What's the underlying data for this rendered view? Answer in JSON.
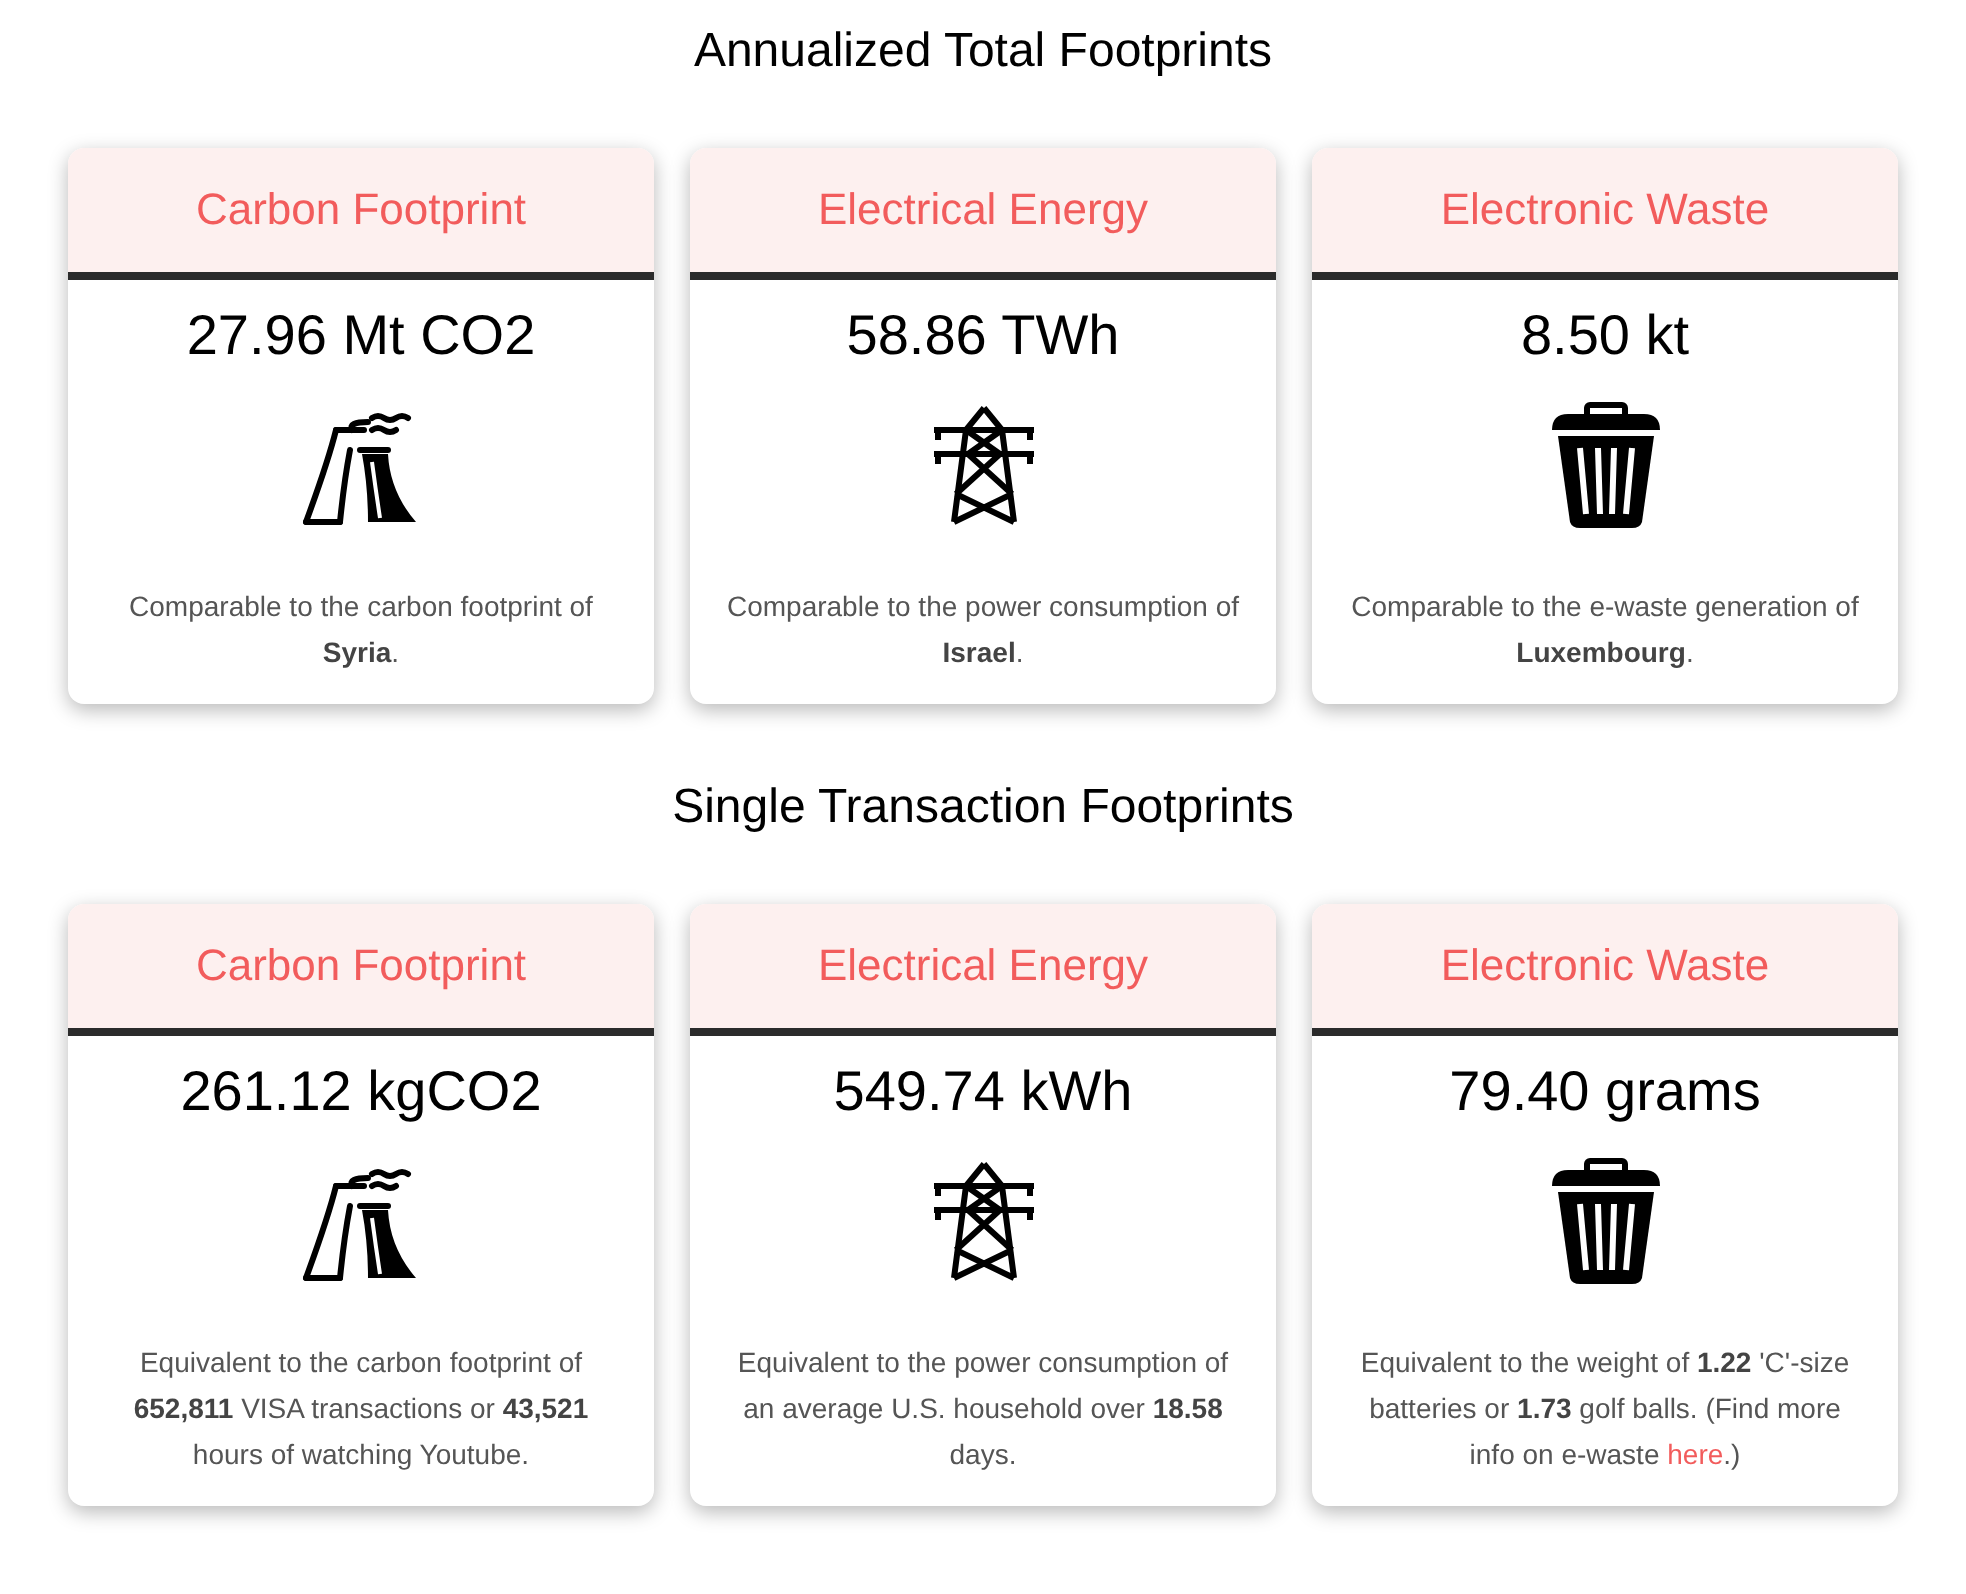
{
  "sections": [
    {
      "heading": "Annualized Total Footprints",
      "cards": [
        {
          "title": "Carbon Footprint",
          "value": "27.96 Mt CO2",
          "kind": "plant",
          "description": "Comparable to the carbon footprint of **Syria**."
        },
        {
          "title": "Electrical Energy",
          "value": "58.86 TWh",
          "kind": "tower",
          "description": "Comparable to the power consumption of **Israel**."
        },
        {
          "title": "Electronic Waste",
          "value": "8.50 kt",
          "kind": "bin",
          "description": "Comparable to the e-waste generation of **Luxembourg**."
        }
      ]
    },
    {
      "heading": "Single Transaction Footprints",
      "cards": [
        {
          "title": "Carbon Footprint",
          "value": "261.12 kgCO2",
          "kind": "plant",
          "description": "Equivalent to the carbon footprint of **652,811** VISA transactions or **43,521** hours of watching Youtube."
        },
        {
          "title": "Electrical Energy",
          "value": "549.74 kWh",
          "kind": "tower",
          "description": "Equivalent to the power consumption of an average U.S. household over **18.58** days."
        },
        {
          "title": "Electronic Waste",
          "value": "79.40 grams",
          "kind": "bin",
          "description": "Equivalent to the weight of **1.22** 'C'-size batteries or **1.73** golf balls. (Find more info on e-waste ",
          "link": "here",
          "after": ".)"
        }
      ]
    }
  ]
}
